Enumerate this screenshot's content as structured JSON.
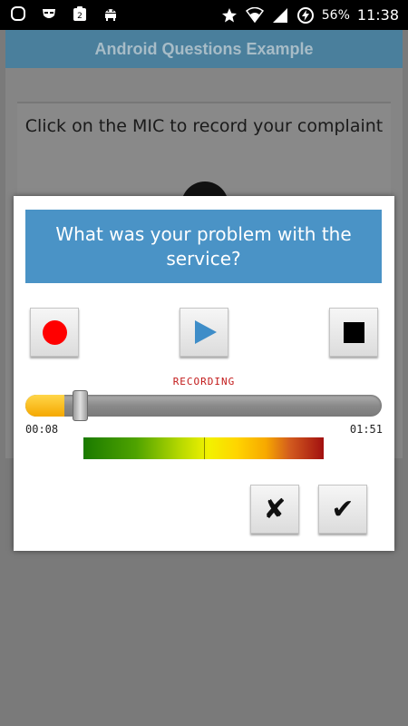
{
  "status_bar": {
    "icons_left": [
      "notification-icon",
      "incognito-icon",
      "clipboard-icon",
      "android-debug-icon"
    ],
    "clipboard_badge": "2",
    "battery": "56%",
    "time": "11:38"
  },
  "app": {
    "title": "Android Questions Example",
    "prompt": "Click on the MIC to record your complaint"
  },
  "dialog": {
    "question": "What was your problem with the service?",
    "record_button_icon": "record-icon",
    "play_button_icon": "play-icon",
    "stop_button_icon": "stop-icon",
    "status_text": "RECORDING",
    "progress_fraction": 0.089,
    "time_start": "00:08",
    "time_end": "01:51",
    "level_fraction": 0.5,
    "cancel_glyph": "✘",
    "ok_glyph": "✔"
  },
  "colors": {
    "accent": "#4a93c6",
    "record": "#ff0000",
    "play": "#3e8dc8",
    "status_text": "#c21a1a",
    "seek_fill": "#f5a800"
  }
}
